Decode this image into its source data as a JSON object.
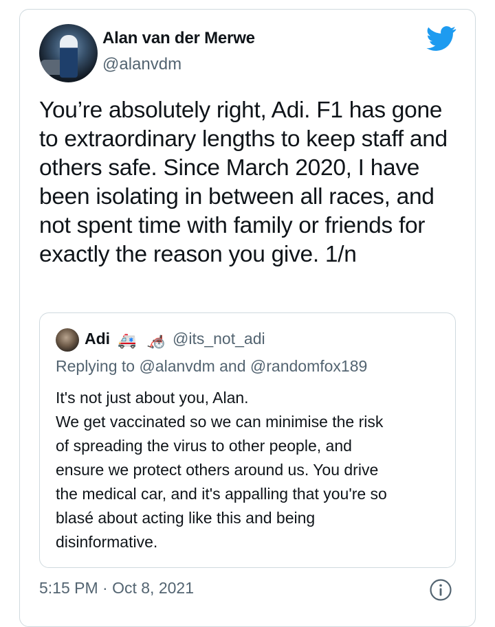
{
  "tweet": {
    "author_name": "Alan van der Merwe",
    "author_handle": "@alanvdm",
    "text": "You’re absolutely right, Adi. F1 has gone to extraordinary lengths to keep staff and others safe. Since March 2020, I have been isolating in between all races, and not spent time with family or friends for exactly the reason you give. 1/n",
    "timestamp": "5:15 PM · Oct 8, 2021"
  },
  "quoted_tweet": {
    "author_name": "Adi",
    "author_emojis": [
      "🚑",
      "🦽"
    ],
    "author_handle": "@its_not_adi",
    "replying_to": "Replying to @alanvdm and @randomfox189",
    "lines": [
      "It's not just about you, Alan.",
      "We get vaccinated so we can minimise the risk",
      "of spreading the virus to other people, and",
      "ensure we protect others around us. You drive",
      "the medical car, and it's appalling that you're so",
      "blasé about acting like this and being",
      "disinformative."
    ]
  },
  "icons": {
    "brand": "twitter-bird-icon",
    "info": "info-icon"
  },
  "colors": {
    "twitter_blue": "#1d9bf0",
    "secondary_text": "#536471",
    "border": "#cfd9de"
  }
}
